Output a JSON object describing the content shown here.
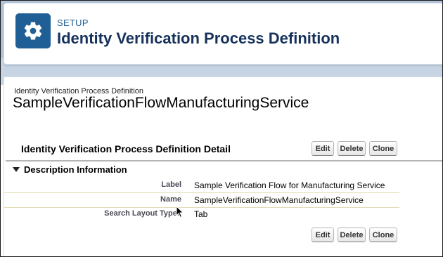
{
  "header": {
    "section_label": "SETUP",
    "title": "Identity Verification Process Definition",
    "icon": "gear-icon",
    "icon_bg": "#1f5f95"
  },
  "record": {
    "type_label": "Identity Verification Process Definition",
    "name": "SampleVerificationFlowManufacturingService"
  },
  "detail": {
    "title": "Identity Verification Process Definition Detail",
    "buttons": {
      "edit": "Edit",
      "delete": "Delete",
      "clone": "Clone"
    }
  },
  "section": {
    "label": "Description Information",
    "fields": [
      {
        "label": "Label",
        "value": "Sample Verification Flow for Manufacturing Service"
      },
      {
        "label": "Name",
        "value": "SampleVerificationFlowManufacturingService"
      },
      {
        "label": "Search Layout Types",
        "value": "Tab"
      }
    ]
  }
}
